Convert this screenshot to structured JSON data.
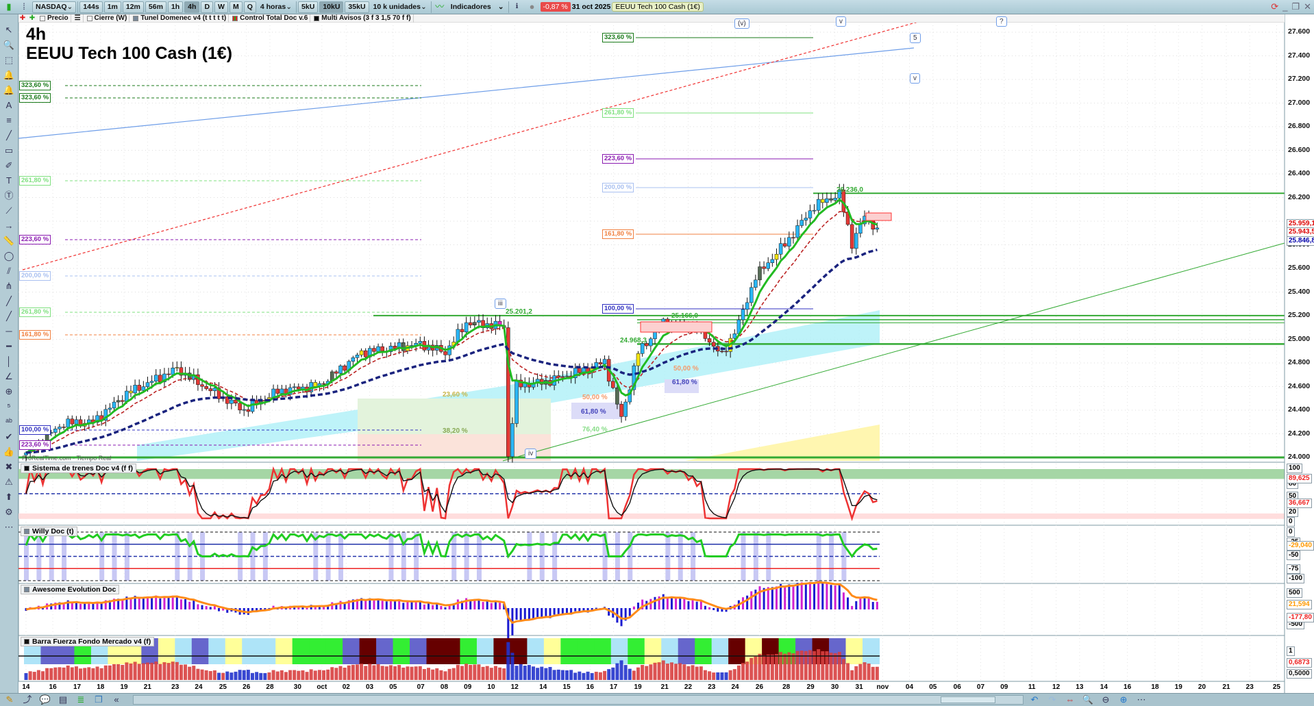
{
  "toolbar": {
    "symbol": "NASDAQ",
    "timeframes": [
      "144s",
      "1m",
      "12m",
      "56m",
      "1h",
      "4h",
      "D",
      "W",
      "M",
      "Q"
    ],
    "active_timeframe": "4h",
    "period_select": "4 horas",
    "units": [
      "5kU",
      "10kU",
      "35kU"
    ],
    "active_unit": "10kU",
    "units_select": "10 k unidades",
    "indicators_label": "Indicadores",
    "change": "-0,87 %",
    "date": "31 oct 2025",
    "instrument": "EEUU Tech 100 Cash (1€)"
  },
  "legend": [
    "Precio",
    "Cierre (W)",
    "Tunel Domenec v4 (t t t t t)",
    "Control Total Doc v.6",
    "Multi Avisos (3 f 3 1,5 70 f f)"
  ],
  "chart": {
    "timeframe": "4h",
    "title": "EEUU Tech 100 Cash (1€)",
    "watermark": "ProRealTime.com - Tiempo Real",
    "price_axis": [
      "27.600",
      "27.400",
      "27.200",
      "27.000",
      "26.800",
      "26.600",
      "26.400",
      "26.200",
      "25.800",
      "25.600",
      "25.400",
      "25.200",
      "25.000",
      "24.800",
      "24.600",
      "24.400",
      "24.200",
      "24.000"
    ],
    "last_prices": [
      "25.959,1",
      "25.943,5",
      "25.846,8"
    ],
    "fib_left": [
      "323,60 %",
      "323,60 %",
      "261,80 %",
      "223,60 %",
      "200,00 %",
      "261,80 %",
      "161,80 %",
      "100,00 %",
      "223,60 %"
    ],
    "fib_mid": [
      "323,60 %",
      "261,80 %",
      "223,60 %",
      "200,00 %",
      "161,80 %",
      "100,00 %"
    ],
    "fib_small": [
      "23,60 %",
      "38,20 %",
      "50,00 %",
      "61,80 %",
      "76,40 %",
      "50,00 %",
      "61,80 %"
    ],
    "price_labels": [
      "25.201,2",
      "25.166,0",
      "24.968,3",
      "26.236,0"
    ],
    "waves": [
      "(v)",
      "v",
      "5",
      "v",
      "?",
      "iii",
      "iv"
    ],
    "price_path": [
      [
        0,
        24040
      ],
      [
        9,
        24290
      ],
      [
        16,
        24300
      ],
      [
        24,
        24540
      ],
      [
        36,
        24750
      ],
      [
        42,
        24610
      ],
      [
        52,
        24400
      ],
      [
        60,
        24560
      ],
      [
        70,
        24610
      ],
      [
        80,
        24890
      ],
      [
        94,
        24960
      ],
      [
        100,
        24890
      ],
      [
        105,
        25140
      ],
      [
        114,
        25110
      ],
      [
        115,
        24010
      ],
      [
        117,
        24610
      ],
      [
        124,
        24640
      ],
      [
        134,
        24750
      ],
      [
        138,
        24810
      ],
      [
        142,
        24330
      ],
      [
        146,
        24890
      ],
      [
        152,
        25140
      ],
      [
        160,
        25110
      ],
      [
        166,
        24860
      ],
      [
        170,
        25140
      ],
      [
        174,
        25530
      ],
      [
        182,
        25850
      ],
      [
        188,
        26130
      ],
      [
        194,
        26230
      ],
      [
        197,
        25810
      ],
      [
        200,
        26040
      ],
      [
        203,
        25943
      ]
    ]
  },
  "panels": {
    "trenes": {
      "title": "Sistema de trenes Doc v4 (f f)",
      "axis": [
        "100",
        "80",
        "50",
        "20",
        "0"
      ],
      "values": [
        "89,625",
        "36,667"
      ]
    },
    "willy": {
      "title": "Willy Doc (t)",
      "axis": [
        "0",
        "-25",
        "-50",
        "-75",
        "-100"
      ],
      "values": [
        "-29,040"
      ]
    },
    "awesome": {
      "title": "Awesome Evolution Doc",
      "axis": [
        "500",
        "-500"
      ],
      "values": [
        "21,594",
        "-177,80"
      ]
    },
    "barra": {
      "title": "Barra Fuerza Fondo Mercado v4 (f)",
      "axis": [
        "1"
      ],
      "values": [
        "0,6873",
        "0,5000"
      ]
    }
  },
  "xaxis": [
    "14",
    "16",
    "17",
    "18",
    "19",
    "21",
    "23",
    "24",
    "25",
    "26",
    "28",
    "30",
    "oct",
    "02",
    "03",
    "05",
    "07",
    "08",
    "09",
    "10",
    "12",
    "14",
    "15",
    "16",
    "17",
    "19",
    "21",
    "22",
    "23",
    "24",
    "26",
    "28",
    "29",
    "30",
    "31",
    "nov",
    "04",
    "05",
    "06",
    "07",
    "09",
    "11",
    "12",
    "13",
    "14",
    "16",
    "18",
    "19",
    "20",
    "21",
    "23",
    "25"
  ],
  "colors": {
    "up": "#29b6f6",
    "down": "#e53935",
    "fast": "#22bb22",
    "mid": "#8b1a1a",
    "slow": "#1a237e",
    "level": "#33aa33"
  }
}
